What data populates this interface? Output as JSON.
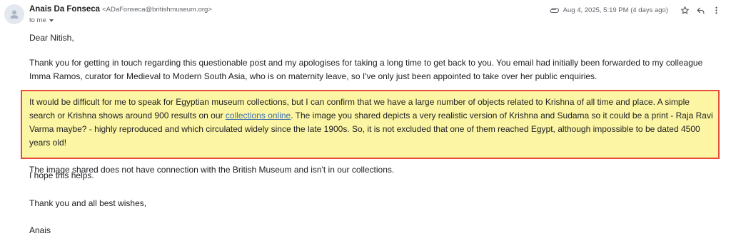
{
  "header": {
    "sender_name": "Anais Da Fonseca",
    "sender_email": "<ADaFonseca@britishmuseum.org>",
    "recipient": "to me",
    "date": "Aug 4, 2025, 5:19 PM (4 days ago)"
  },
  "icons": {
    "avatar": "person-icon",
    "attachment": "paperclip-icon",
    "star": "star-icon",
    "reply": "reply-icon",
    "more": "more-vert-icon",
    "recipient_details": "chevron-down-icon"
  },
  "body": {
    "greeting": "Dear Nitish,",
    "para1": "Thank you for getting in touch regarding this questionable post and my apologises for taking a long time to get back to you. You email had initially been forwarded to my colleague Imma Ramos, curator for Medieval to Modern South Asia, who is on maternity leave, so I've only just been appointed to take over her public enquiries.",
    "highlight": {
      "para_a_1": "It would be difficult for me to speak for Egyptian museum collections, but I can confirm that we have a large number of objects related to Krishna of all time and place. A simple search or Krishna shows around 900 results on our ",
      "link_text": "collections online",
      "para_a_2": ". The image you shared depicts a very realistic version of Krishna and Sudama so it could be a print - Raja Ravi Varma maybe? - highly reproduced and which circulated widely since the late 1900s. So, it is not excluded that one of them reached Egypt, although impossible to be dated 4500 years old!",
      "para_b": "The image shared does not have connection with the British Museum and isn't in our collections."
    },
    "para_help": "I hope this helps.",
    "para_thanks": "Thank you and all best wishes,",
    "signature": "Anais"
  },
  "colors": {
    "highlight_bg": "#fcf5a4",
    "highlight_border": "#e84d3c",
    "link": "#3c6fb0"
  }
}
